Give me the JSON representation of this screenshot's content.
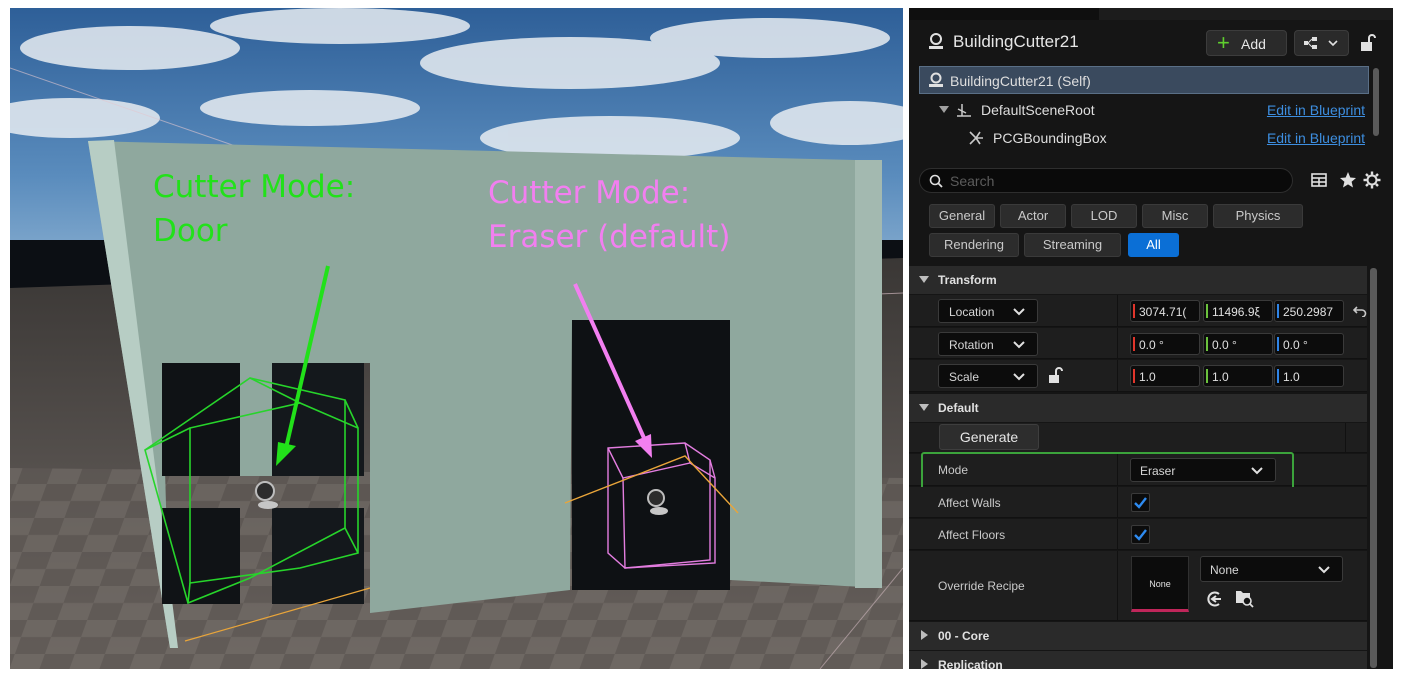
{
  "viewport": {
    "annotations": [
      {
        "line1": "Cutter Mode:",
        "line2": "Door",
        "color": "#22e11a"
      },
      {
        "line1": "Cutter Mode:",
        "line2": "Eraser (default)",
        "color": "#f27ff0"
      }
    ]
  },
  "panel": {
    "actor_title": "BuildingCutter21",
    "add_label": "Add",
    "components": [
      {
        "name": "BuildingCutter21 (Self)",
        "edit": ""
      },
      {
        "name": "DefaultSceneRoot",
        "edit": "Edit in Blueprint"
      },
      {
        "name": "PCGBoundingBox",
        "edit": "Edit in Blueprint"
      }
    ],
    "search": {
      "placeholder": "Search"
    },
    "filters": [
      "General",
      "Actor",
      "LOD",
      "Misc",
      "Physics",
      "Rendering",
      "Streaming",
      "All"
    ],
    "active_filter": "All",
    "transform": {
      "title": "Transform",
      "location": {
        "label": "Location",
        "x": "3074.71(",
        "y": "11496.9ξ",
        "z": "250.2987"
      },
      "rotation": {
        "label": "Rotation",
        "x": "0.0 °",
        "y": "0.0 °",
        "z": "0.0 °"
      },
      "scale": {
        "label": "Scale",
        "x": "1.0",
        "y": "1.0",
        "z": "1.0"
      }
    },
    "default": {
      "title": "Default",
      "generate_label": "Generate",
      "mode_label": "Mode",
      "mode_value": "Eraser",
      "affect_walls_label": "Affect Walls",
      "affect_walls": true,
      "affect_floors_label": "Affect Floors",
      "affect_floors": true,
      "override_recipe_label": "Override Recipe",
      "override_recipe_thumb": "None",
      "override_recipe_value": "None"
    },
    "core_title": "00 - Core",
    "replication_title": "Replication",
    "accent_colors": {
      "x": "#e0352b",
      "y": "#6bc23d",
      "z": "#2f84e6",
      "selection": "#0b6fd6",
      "highlight": "#3ba33b"
    }
  }
}
